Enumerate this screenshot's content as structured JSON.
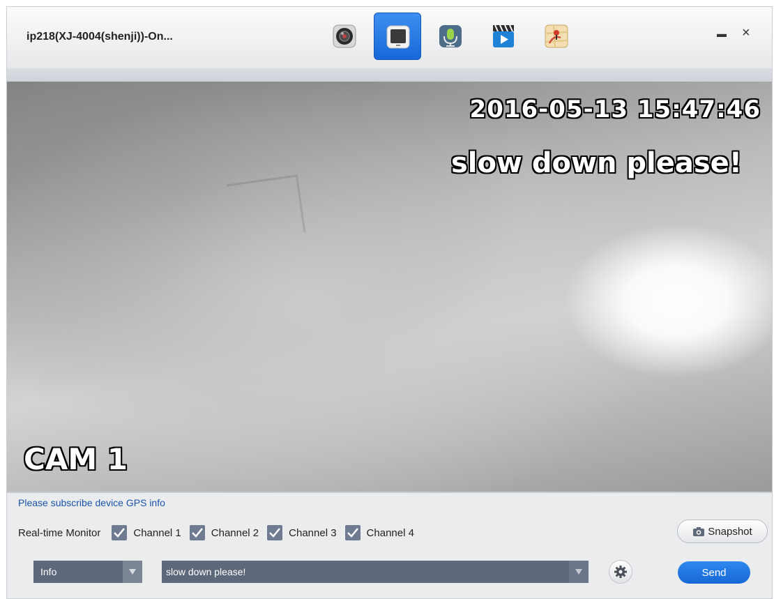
{
  "window": {
    "title": "ip218(XJ-4004(shenji))-On...",
    "controls": {
      "maximize_icon": "maximize-icon",
      "close_icon": "close-icon",
      "close_glyph": "×",
      "maximize_glyph": "▬"
    }
  },
  "toolbar": {
    "buttons": [
      {
        "icon": "camera-lens-icon",
        "active": false
      },
      {
        "icon": "monitor-icon",
        "active": true
      },
      {
        "icon": "microphone-icon",
        "active": false
      },
      {
        "icon": "video-clapper-icon",
        "active": false
      },
      {
        "icon": "map-pin-icon",
        "active": false
      }
    ],
    "accent": "#1e74e0"
  },
  "video": {
    "timestamp": "2016-05-13 15:47:46",
    "overlay_message": "slow down please!",
    "camera_label": "CAM 1"
  },
  "panel": {
    "gps_link": "Please subscribe device GPS info",
    "monitor_label": "Real-time Monitor",
    "channels": [
      {
        "label": "Channel 1",
        "checked": true
      },
      {
        "label": "Channel 2",
        "checked": true
      },
      {
        "label": "Channel 3",
        "checked": true
      },
      {
        "label": "Channel 4",
        "checked": true
      }
    ],
    "snapshot_label": "Snapshot",
    "type_select": {
      "value": "Info"
    },
    "message_input": {
      "value": "slow down please!"
    },
    "send_label": "Send",
    "colors": {
      "send": "#1e74e0",
      "link": "#1b53a8",
      "field": "#5d687a"
    }
  }
}
